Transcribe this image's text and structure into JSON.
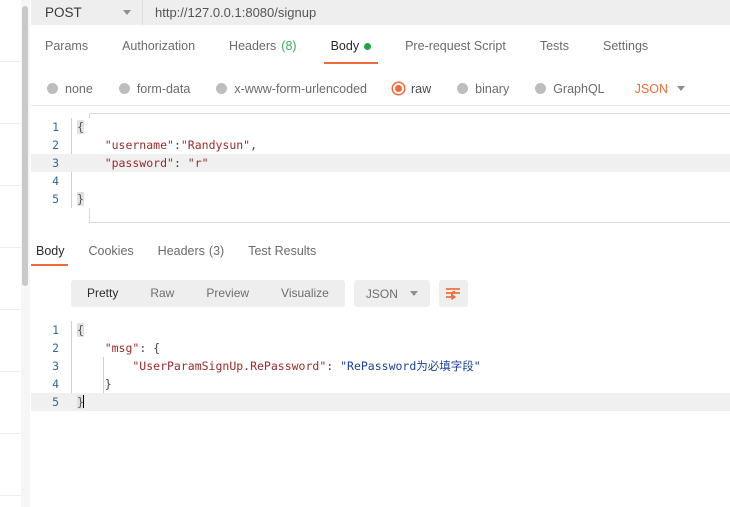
{
  "request_bar": {
    "method": "POST",
    "method_caret_icon": "chevron-down-icon",
    "url": "http://127.0.0.1:8080/signup"
  },
  "request_tabs": [
    {
      "label": "Params",
      "badge": "",
      "active": false,
      "dot": false
    },
    {
      "label": "Authorization",
      "badge": "",
      "active": false,
      "dot": false
    },
    {
      "label": "Headers",
      "badge": "(8)",
      "active": false,
      "dot": false
    },
    {
      "label": "Body",
      "badge": "",
      "active": true,
      "dot": true
    },
    {
      "label": "Pre-request Script",
      "badge": "",
      "active": false,
      "dot": false
    },
    {
      "label": "Tests",
      "badge": "",
      "active": false,
      "dot": false
    },
    {
      "label": "Settings",
      "badge": "",
      "active": false,
      "dot": false
    }
  ],
  "body_type_options": [
    {
      "label": "none",
      "selected": false
    },
    {
      "label": "form-data",
      "selected": false
    },
    {
      "label": "x-www-form-urlencoded",
      "selected": false
    },
    {
      "label": "raw",
      "selected": true
    },
    {
      "label": "binary",
      "selected": false
    },
    {
      "label": "GraphQL",
      "selected": false
    }
  ],
  "raw_format": {
    "value": "JSON",
    "caret_icon": "chevron-down-icon"
  },
  "request_body": {
    "line_numbers": [
      "1",
      "2",
      "3",
      "4",
      "5"
    ],
    "lines": [
      "{",
      "    \"username\":\"Randysun\",",
      "    \"password\": \"r\"",
      "",
      "}"
    ],
    "active_line": 3
  },
  "response_tabs": [
    {
      "label": "Body",
      "badge": "",
      "active": true
    },
    {
      "label": "Cookies",
      "badge": "",
      "active": false
    },
    {
      "label": "Headers",
      "badge": "(3)",
      "active": false
    },
    {
      "label": "Test Results",
      "badge": "",
      "active": false
    }
  ],
  "response_view_modes": [
    {
      "label": "Pretty",
      "active": true
    },
    {
      "label": "Raw",
      "active": false
    },
    {
      "label": "Preview",
      "active": false
    },
    {
      "label": "Visualize",
      "active": false
    }
  ],
  "response_format": {
    "value": "JSON",
    "caret_icon": "chevron-down-icon"
  },
  "wrap_lines_icon": "wrap-lines-icon",
  "response_body": {
    "line_numbers": [
      "1",
      "2",
      "3",
      "4",
      "5"
    ],
    "lines": [
      "{",
      "    \"msg\": {",
      "        \"UserParamSignUp.RePassword\": \"RePassword为必填字段\"",
      "    }",
      "}"
    ],
    "key_1": "\"msg\"",
    "key_2": "\"UserParamSignUp.RePassword\"",
    "value_2": "\"RePassword为必填字段\"",
    "active_line": 5
  },
  "colors": {
    "accent": "#ef6c3a",
    "green_badge": "#3bae5a",
    "json_label": "#ef6c3a",
    "line_number": "#2a6b9e",
    "json_key": "#9c2a2a",
    "json_value": "#1a3f9e"
  }
}
